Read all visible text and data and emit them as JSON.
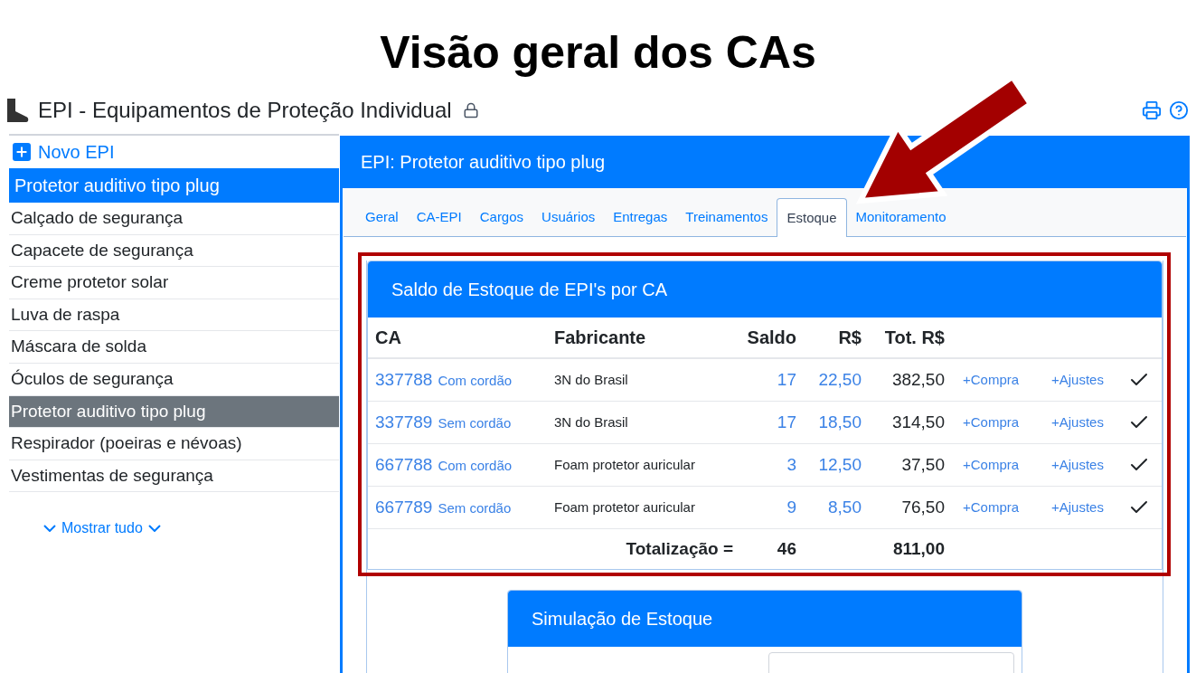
{
  "annotation": {
    "title": "Visão geral dos CAs"
  },
  "page": {
    "title": "EPI - Equipamentos de Proteção Individual"
  },
  "sidebar": {
    "new_button": "Novo EPI",
    "current": "Protetor auditivo tipo plug",
    "items": [
      {
        "label": "Calçado de segurança",
        "selected": false
      },
      {
        "label": "Capacete de segurança",
        "selected": false
      },
      {
        "label": "Creme protetor solar",
        "selected": false
      },
      {
        "label": "Luva de raspa",
        "selected": false
      },
      {
        "label": "Máscara de solda",
        "selected": false
      },
      {
        "label": "Óculos de segurança",
        "selected": false
      },
      {
        "label": "Protetor auditivo tipo plug",
        "selected": true
      },
      {
        "label": "Respirador (poeiras e névoas)",
        "selected": false
      },
      {
        "label": "Vestimentas de segurança",
        "selected": false
      }
    ],
    "show_all": "Mostrar tudo"
  },
  "panel": {
    "title": "EPI: Protetor auditivo tipo plug",
    "tabs": [
      {
        "label": "Geral",
        "selected": false
      },
      {
        "label": "CA-EPI",
        "selected": false
      },
      {
        "label": "Cargos",
        "selected": false
      },
      {
        "label": "Usuários",
        "selected": false
      },
      {
        "label": "Entregas",
        "selected": false
      },
      {
        "label": "Treinamentos",
        "selected": false
      },
      {
        "label": "Estoque",
        "selected": true
      },
      {
        "label": "Monitoramento",
        "selected": false
      }
    ],
    "stock_card": {
      "title": "Saldo de Estoque de EPI's por CA",
      "columns": [
        "CA",
        "Fabricante",
        "Saldo",
        "R$",
        "Tot. R$"
      ],
      "rows": [
        {
          "ca": "337788",
          "description": "Com cordão",
          "manufacturer": "3N do Brasil",
          "balance": "17",
          "price": "22,50",
          "total": "382,50",
          "purchase": "+Compra",
          "adjust": "+Ajustes",
          "checked": true
        },
        {
          "ca": "337789",
          "description": "Sem cordão",
          "manufacturer": "3N do Brasil",
          "balance": "17",
          "price": "18,50",
          "total": "314,50",
          "purchase": "+Compra",
          "adjust": "+Ajustes",
          "checked": true
        },
        {
          "ca": "667788",
          "description": "Com cordão",
          "manufacturer": "Foam protetor auricular",
          "balance": "3",
          "price": "12,50",
          "total": "37,50",
          "purchase": "+Compra",
          "adjust": "+Ajustes",
          "checked": true
        },
        {
          "ca": "667789",
          "description": "Sem cordão",
          "manufacturer": "Foam protetor auricular",
          "balance": "9",
          "price": "8,50",
          "total": "76,50",
          "purchase": "+Compra",
          "adjust": "+Ajustes",
          "checked": true
        }
      ],
      "totals": {
        "label": "Totalização =",
        "balance": "46",
        "total": "811,00"
      }
    },
    "simulation": {
      "title": "Simulação de Estoque"
    }
  }
}
